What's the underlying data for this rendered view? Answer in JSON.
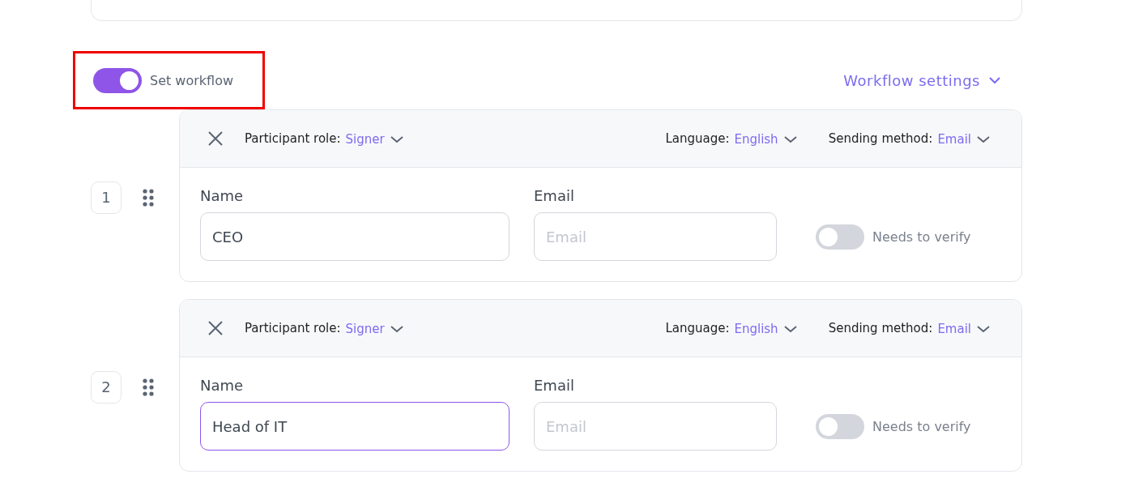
{
  "workflow_toggle": {
    "label": "Set workflow",
    "on": true,
    "highlighted": true
  },
  "workflow_settings": {
    "label": "Workflow settings"
  },
  "participants": [
    {
      "number": "1",
      "role_label": "Participant role:",
      "role": "Signer",
      "language_label": "Language:",
      "language": "English",
      "method_label": "Sending method:",
      "method": "Email",
      "name_label": "Name",
      "name_value": "CEO",
      "name_focused": false,
      "email_label": "Email",
      "email_placeholder": "Email",
      "verify_label": "Needs to verify",
      "verify_on": false
    },
    {
      "number": "2",
      "role_label": "Participant role:",
      "role": "Signer",
      "language_label": "Language:",
      "language": "English",
      "method_label": "Sending method:",
      "method": "Email",
      "name_label": "Name",
      "name_value": "Head of IT",
      "name_focused": true,
      "email_label": "Email",
      "email_placeholder": "Email",
      "verify_label": "Needs to verify",
      "verify_on": false
    }
  ]
}
